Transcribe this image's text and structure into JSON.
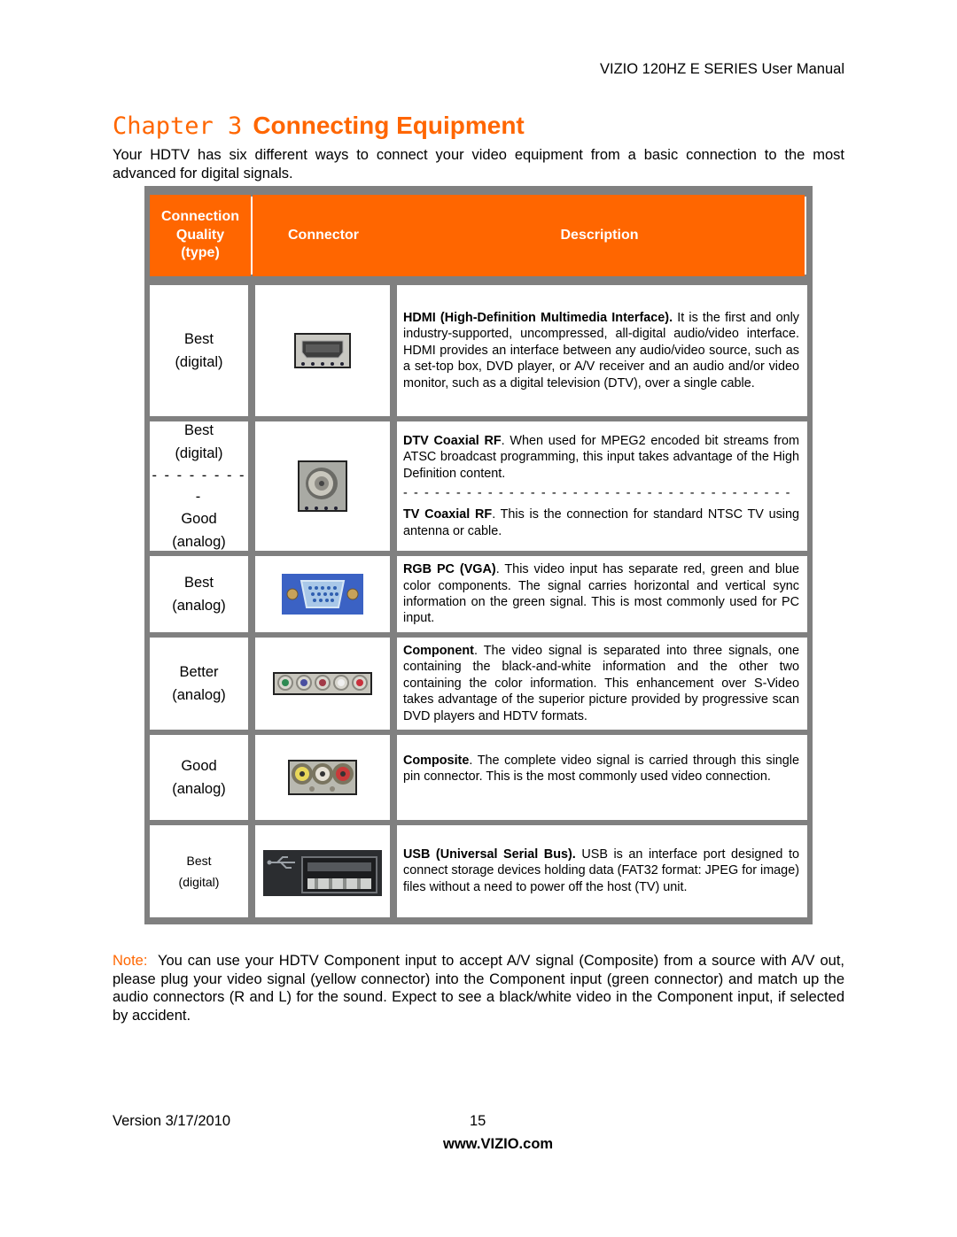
{
  "header": {
    "manual_title": "VIZIO 120HZ E SERIES User Manual"
  },
  "chapter": {
    "label": "Chapter 3",
    "title": "Connecting Equipment"
  },
  "intro": "Your HDTV has six different ways to connect your video equipment from a basic connection to the most advanced for digital signals.",
  "table": {
    "columns": {
      "quality": "Connection Quality (type)",
      "quality_lines": [
        "Connection",
        "Quality",
        "(type)"
      ],
      "connector": "Connector",
      "description": "Description"
    },
    "header_color": "#ff6600",
    "rows": [
      {
        "quality": [
          "Best",
          "(digital)"
        ],
        "connector_icon": "hdmi-port",
        "desc_bold": "HDMI (High-Definition Multimedia Interface).",
        "desc_text": " It is the first and only industry-supported, uncompressed, all-digital audio/video interface. HDMI provides an interface between any audio/video source, such as a set-top box, DVD player, or A/V receiver and an audio and/or video monitor, such as a digital television (DTV), over a single cable."
      },
      {
        "quality": [
          "Best",
          "(digital)"
        ],
        "quality_separator": "- - - - - - - - -",
        "quality_alt": [
          "Good",
          "(analog)"
        ],
        "connector_icon": "coaxial-rf-port",
        "desc_bold": "DTV Coaxial RF",
        "desc_text": ".  When used for MPEG2 encoded bit streams from ATSC broadcast programming, this input takes advantage of the High Definition content.",
        "desc_separator": "- - - - - - - - - - - - - - - - - - - - - - - - - - - - - - - - - - - - -",
        "desc_alt_bold": "TV Coaxial RF",
        "desc_alt_text": ". This is the connection for standard NTSC TV using antenna or cable."
      },
      {
        "quality": [
          "Best",
          "(analog)"
        ],
        "connector_icon": "vga-port",
        "desc_bold": "RGB PC (VGA)",
        "desc_text": ". This video input has separate red, green and blue color components.  The signal carries horizontal and vertical sync information on the green signal.  This is most commonly used for PC input."
      },
      {
        "quality": [
          "Better",
          "(analog)"
        ],
        "connector_icon": "component-ports",
        "desc_bold": "Component",
        "desc_text": ". The video signal is separated into three signals, one containing the black-and-white information and the other two containing the color information. This enhancement over S-Video takes advantage of the superior picture provided by progressive scan DVD players and HDTV formats."
      },
      {
        "quality": [
          "Good",
          "(analog)"
        ],
        "connector_icon": "composite-ports",
        "desc_bold": "Composite",
        "desc_text": ". The complete video signal is carried through this single pin connector. This is the most commonly used video connection."
      },
      {
        "quality": [
          "Best",
          "(digital)"
        ],
        "connector_icon": "usb-port",
        "desc_bold": "USB (Universal Serial Bus).",
        "desc_text": " USB is an interface port designed to connect storage devices holding data (FAT32 format: JPEG for image) files without a need to power off the host (TV) unit."
      }
    ]
  },
  "note": {
    "label": "Note:",
    "text": "  You can use your HDTV Component input to accept A/V signal (Composite) from a source with A/V out, please plug your video signal (yellow connector) into the Component input (green connector) and match up the audio connectors (R and L) for the sound. Expect to see a black/white video in the Component input, if selected by accident."
  },
  "footer": {
    "version": "Version 3/17/2010",
    "page": "15",
    "url": "www.VIZIO.com"
  },
  "colors": {
    "accent": "#ff6600",
    "table_border": "#808080"
  }
}
